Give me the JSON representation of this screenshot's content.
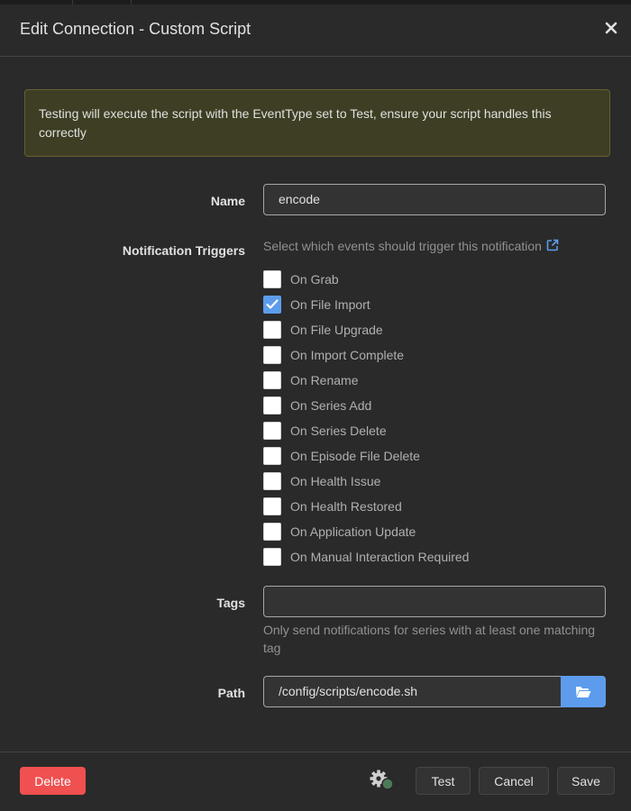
{
  "dialog": {
    "title": "Edit Connection - Custom Script"
  },
  "alert": {
    "text": "Testing will execute the script with the EventType set to Test, ensure your script handles this correctly"
  },
  "fields": {
    "name": {
      "label": "Name",
      "value": "encode"
    },
    "triggers": {
      "label": "Notification Triggers",
      "help": "Select which events should trigger this notification",
      "items": [
        {
          "label": "On Grab",
          "checked": false
        },
        {
          "label": "On File Import",
          "checked": true
        },
        {
          "label": "On File Upgrade",
          "checked": false
        },
        {
          "label": "On Import Complete",
          "checked": false
        },
        {
          "label": "On Rename",
          "checked": false
        },
        {
          "label": "On Series Add",
          "checked": false
        },
        {
          "label": "On Series Delete",
          "checked": false
        },
        {
          "label": "On Episode File Delete",
          "checked": false
        },
        {
          "label": "On Health Issue",
          "checked": false
        },
        {
          "label": "On Health Restored",
          "checked": false
        },
        {
          "label": "On Application Update",
          "checked": false
        },
        {
          "label": "On Manual Interaction Required",
          "checked": false
        }
      ]
    },
    "tags": {
      "label": "Tags",
      "value": "",
      "help": "Only send notifications for series with at least one matching tag"
    },
    "path": {
      "label": "Path",
      "value": "/config/scripts/encode.sh"
    }
  },
  "footer": {
    "delete_label": "Delete",
    "test_label": "Test",
    "cancel_label": "Cancel",
    "save_label": "Save"
  },
  "icons": {
    "close": "close-icon",
    "external_link": "external-link-icon",
    "folder": "folder-open-icon",
    "gears": "gears-icon"
  },
  "colors": {
    "primary": "#5d9cec",
    "danger": "#f05050",
    "warning_bg": "#3e3e24",
    "warning_border": "#66602f"
  }
}
